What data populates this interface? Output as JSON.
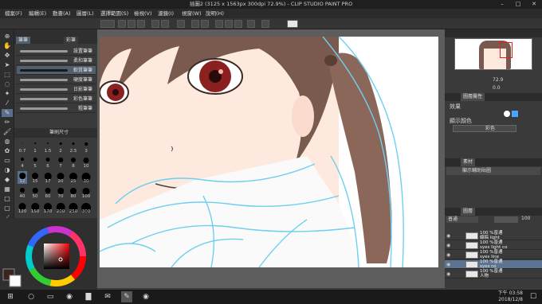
{
  "window": {
    "title": "插圖2 (3125 x 1563px 300dpi 72.9%) - CLIP STUDIO PAINT PRO"
  },
  "menu": [
    "檔案(F)",
    "編輯(E)",
    "動畫(A)",
    "圖層(L)",
    "選擇範圍(S)",
    "檢視(V)",
    "濾鏡(I)",
    "視窗(W)",
    "說明(H)"
  ],
  "subtool": {
    "tabs": [
      "筆筆",
      "彩筆"
    ],
    "brushes": [
      "設置筆筆",
      "柔和筆筆",
      "軟質筆筆",
      "硬度筆筆",
      "日影筆筆",
      "彩色筆筆",
      "粗筆筆"
    ],
    "selected_index": 2
  },
  "tool_property": {
    "label": "筆刷尺寸"
  },
  "brush_sizes": {
    "rows": [
      [
        "0.7",
        "1",
        "1.5",
        "2",
        "2.5",
        "3"
      ],
      [
        "4",
        "5",
        "6",
        "7",
        "8",
        "10"
      ],
      [
        "12",
        "15",
        "17",
        "20",
        "25",
        "30"
      ],
      [
        "40",
        "50",
        "60",
        "70",
        "80",
        "100"
      ],
      [
        "120",
        "150",
        "170",
        "200",
        "250",
        "300"
      ]
    ],
    "selected": "12"
  },
  "navigator": {
    "zoom": "72.9",
    "angle": "0.0"
  },
  "properties": {
    "tab": "圖層屬性",
    "effect_label": "效果",
    "display_color_label": "顯示顏色",
    "display_color_value": "彩色"
  },
  "materials": {
    "tab": "素材",
    "selected": "顯示輔助貼圖"
  },
  "layers": {
    "tab": "圖層",
    "blend_mode": "普通",
    "opacity": "100",
    "items": [
      {
        "name": "100 %普通\n線稿 light",
        "selected": false
      },
      {
        "name": "100 %普通\nsyes light co",
        "selected": false
      },
      {
        "name": "100 %普通\nsyes line",
        "selected": false
      },
      {
        "name": "100 %普通\nsyes co",
        "selected": true
      },
      {
        "name": "100 %普通\n人物",
        "selected": false
      }
    ]
  },
  "taskbar": {
    "time": "下午 03:58",
    "date": "2018/12/8"
  },
  "colors": {
    "accent": "#5b7290",
    "sketch": "#6ecff0"
  }
}
